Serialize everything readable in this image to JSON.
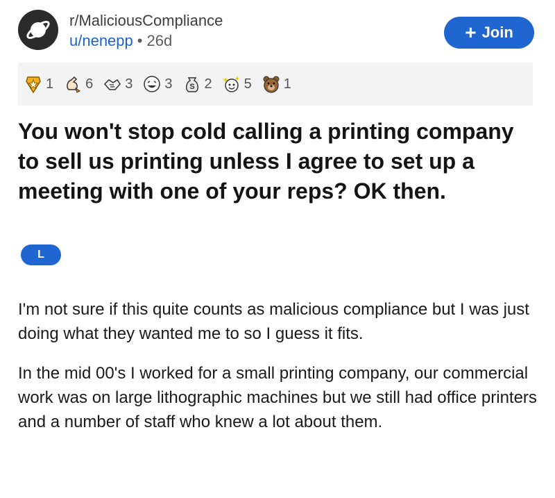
{
  "post": {
    "subreddit": "r/MaliciousCompliance",
    "author": "u/nenepp",
    "separator": "•",
    "age": "26d",
    "join_label": "Join",
    "title": "You won't stop cold calling a printing company to sell us printing unless I agree to set up a meeting with one of your reps? OK then.",
    "flair": "L",
    "paragraphs": [
      "I'm not sure if this quite counts as malicious compliance but I was just doing what they wanted me to so I guess it fits.",
      "In the mid 00's I worked for a small printing company, our commercial work was on large lithographic machines but we still had office printers and a number of staff who knew a lot about them."
    ]
  },
  "awards": [
    {
      "icon": "star-badge-icon",
      "count": "1"
    },
    {
      "icon": "rocket-hand-icon",
      "count": "6"
    },
    {
      "icon": "shaking-hands-icon",
      "count": "3"
    },
    {
      "icon": "laughing-face-icon",
      "count": "3"
    },
    {
      "icon": "dollar-bag-icon",
      "count": "2"
    },
    {
      "icon": "sparkle-face-icon",
      "count": "5"
    },
    {
      "icon": "bear-icon",
      "count": "1"
    }
  ],
  "colors": {
    "accent": "#1f66d1",
    "award_bar_bg": "#f3f3f3"
  }
}
